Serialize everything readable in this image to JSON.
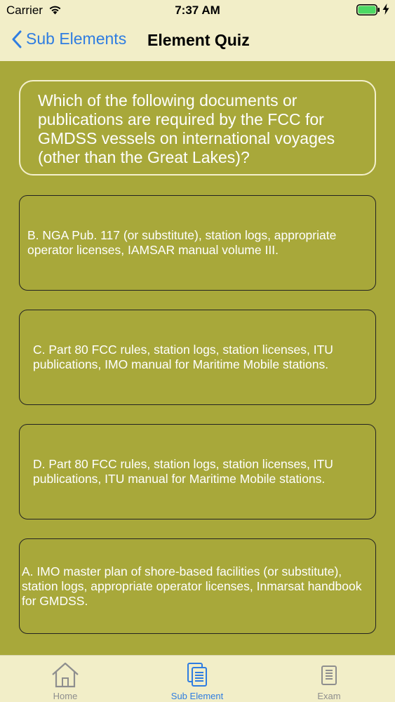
{
  "status": {
    "carrier": "Carrier",
    "time": "7:37 AM"
  },
  "nav": {
    "back_label": "Sub Elements",
    "title": "Element Quiz"
  },
  "question": "Which of the following documents or publications are required by the FCC for GMDSS vessels on international voyages (other than the Great Lakes)?",
  "answers": [
    "B. NGA Pub. 117 (or substitute), station logs, appropriate operator licenses, IAMSAR manual volume III.",
    "C. Part 80 FCC rules, station logs, station licenses, ITU publications, IMO manual for Maritime Mobile stations.",
    "D. Part 80 FCC rules, station logs, station licenses, ITU publications, ITU manual for Maritime Mobile stations.",
    "A. IMO master plan of shore-based facilities (or substitute), station logs, appropriate operator licenses, Inmarsat handbook for GMDSS."
  ],
  "tabs": [
    {
      "label": "Home",
      "icon": "home-icon",
      "active": false
    },
    {
      "label": "Sub Element",
      "icon": "documents-icon",
      "active": true
    },
    {
      "label": "Exam",
      "icon": "document-icon",
      "active": false
    }
  ],
  "colors": {
    "background": "#a8a83a",
    "bar": "#f2eec8",
    "accent": "#2f7de1",
    "inactive_tab": "#8e8e8e"
  }
}
